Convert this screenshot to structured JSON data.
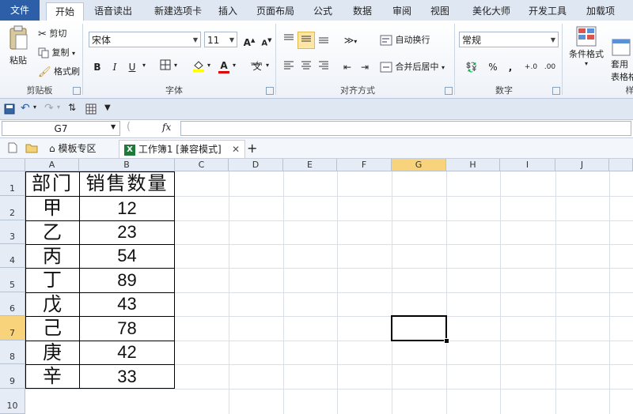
{
  "ribbon_tabs": [
    "文件",
    "开始",
    "语音读出",
    "新建选项卡",
    "插入",
    "页面布局",
    "公式",
    "数据",
    "审阅",
    "视图",
    "美化大师",
    "开发工具",
    "加载项"
  ],
  "clipboard": {
    "paste": "粘贴",
    "cut": "剪切",
    "copy": "复制",
    "format_painter": "格式刷",
    "label": "剪贴板"
  },
  "font": {
    "name": "宋体",
    "size": "11",
    "label": "字体",
    "bold": "B",
    "italic": "I",
    "underline": "U",
    "grow": "A",
    "shrink": "A",
    "font_color": "A",
    "phonetic": "wén"
  },
  "alignment": {
    "wrap": "自动换行",
    "merge": "合并后居中",
    "label": "对齐方式"
  },
  "number": {
    "format": "常规",
    "percent": "%",
    "comma": ",",
    "label": "数字"
  },
  "styles": {
    "conditional": "条件格式",
    "table_format": "套用\n表格格",
    "label": "样"
  },
  "formula_bar": {
    "name_box": "G7",
    "fx": "fx",
    "content": ""
  },
  "doc_tabs": {
    "template": "模板专区",
    "workbook": "工作簿1 [兼容模式]",
    "add": "+"
  },
  "columns": [
    "A",
    "B",
    "C",
    "D",
    "E",
    "F",
    "G",
    "H",
    "I",
    "J"
  ],
  "rows": [
    "1",
    "2",
    "3",
    "4",
    "5",
    "6",
    "7",
    "8",
    "9",
    "10"
  ],
  "selected_cell": "G7",
  "table": {
    "headers": [
      "部门",
      "销售数量"
    ],
    "rows": [
      [
        "甲",
        "12"
      ],
      [
        "乙",
        "23"
      ],
      [
        "丙",
        "54"
      ],
      [
        "丁",
        "89"
      ],
      [
        "戊",
        "43"
      ],
      [
        "己",
        "78"
      ],
      [
        "庚",
        "42"
      ],
      [
        "辛",
        "33"
      ]
    ]
  },
  "colors": {
    "file_tab": "#2c5fa8",
    "selection_header": "#f9d27c",
    "header_bg": "#e6ecf5"
  }
}
